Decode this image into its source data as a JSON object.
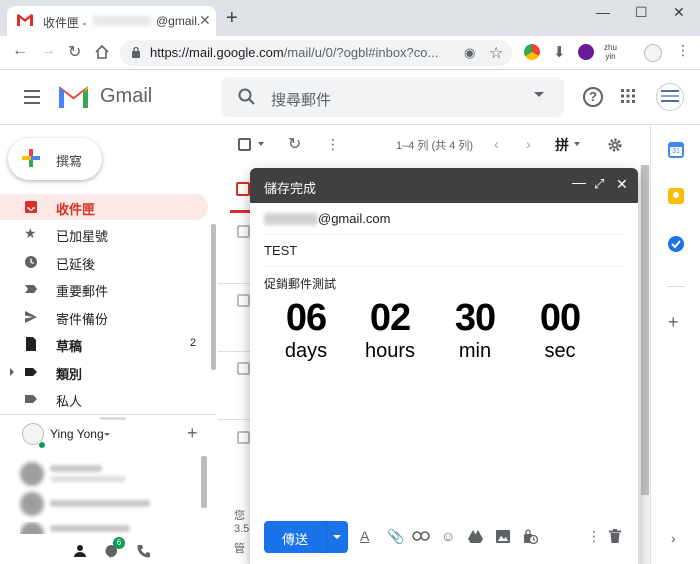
{
  "browser": {
    "tab_title": "收件匣 -",
    "tab_email": "@gmail.",
    "tab_close": "✕",
    "new_tab": "+",
    "url_host": "https://mail.google.com",
    "url_path": "/mail/u/0/?ogbl#inbox?co...",
    "ext_zhuyin_top": "zhu",
    "ext_zhuyin_bottom": "yin"
  },
  "header": {
    "product": "Gmail",
    "search_placeholder": "搜尋郵件"
  },
  "sidebar": {
    "compose_label": "撰寫",
    "items": [
      {
        "label": "收件匣",
        "count": ""
      },
      {
        "label": "已加星號",
        "count": ""
      },
      {
        "label": "已延後",
        "count": ""
      },
      {
        "label": "重要郵件",
        "count": ""
      },
      {
        "label": "寄件備份",
        "count": ""
      },
      {
        "label": "草稿",
        "count": "2"
      },
      {
        "label": "類別",
        "count": ""
      },
      {
        "label": "私人",
        "count": ""
      }
    ]
  },
  "hangouts": {
    "user_name": "Ying Yong",
    "badge_count": "6"
  },
  "toolbar": {
    "pager": "1–4 列 (共 4 列)",
    "input_tool": "拼"
  },
  "list_fragments": {
    "line1": "您",
    "line2": "3.5",
    "line3": "管"
  },
  "compose": {
    "title": "儲存完成",
    "to_suffix": "@gmail.com",
    "subject": "TEST",
    "body_title": "促銷郵件測試",
    "countdown": [
      {
        "num": "06",
        "label": "days"
      },
      {
        "num": "02",
        "label": "hours"
      },
      {
        "num": "30",
        "label": "min"
      },
      {
        "num": "00",
        "label": "sec"
      }
    ],
    "send_label": "傳送"
  },
  "colors": {
    "accent_red": "#d93025",
    "send_blue": "#1a73e8",
    "compose_header": "#404040"
  }
}
